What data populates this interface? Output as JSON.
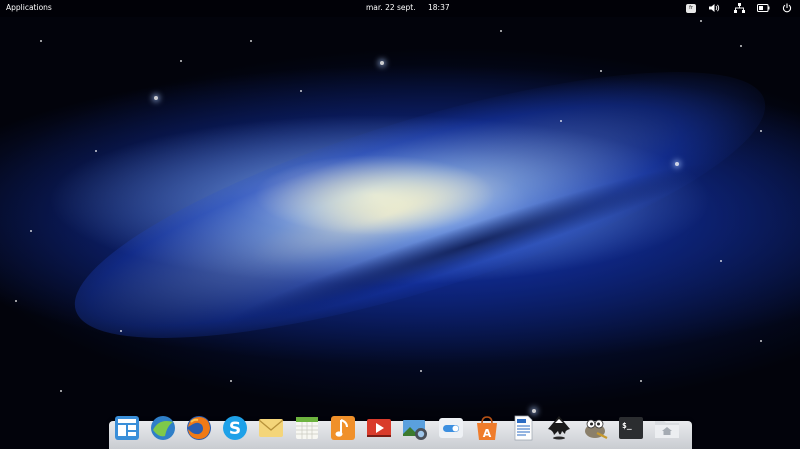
{
  "panel": {
    "applications_label": "Applications",
    "date": "mar. 22 sept.",
    "time": "18:37",
    "keyboard_layout": "fr"
  },
  "indicators": [
    {
      "name": "keyboard-layout",
      "icon": "keyboard-icon"
    },
    {
      "name": "sound",
      "icon": "volume-icon"
    },
    {
      "name": "network",
      "icon": "network-icon"
    },
    {
      "name": "battery",
      "icon": "battery-icon"
    },
    {
      "name": "session",
      "icon": "power-icon"
    }
  ],
  "dock": {
    "items": [
      {
        "name": "multitasking-view",
        "icon": "multitasking-icon"
      },
      {
        "name": "midori-browser",
        "icon": "midori-icon"
      },
      {
        "name": "firefox",
        "icon": "firefox-icon"
      },
      {
        "name": "skype",
        "icon": "skype-icon"
      },
      {
        "name": "mail",
        "icon": "mail-icon"
      },
      {
        "name": "calendar",
        "icon": "calendar-icon"
      },
      {
        "name": "music",
        "icon": "music-icon"
      },
      {
        "name": "videos",
        "icon": "videos-icon"
      },
      {
        "name": "photos",
        "icon": "photos-icon"
      },
      {
        "name": "system-settings",
        "icon": "settings-switch-icon"
      },
      {
        "name": "app-center",
        "icon": "app-center-icon"
      },
      {
        "name": "text-editor",
        "icon": "document-icon"
      },
      {
        "name": "inkscape",
        "icon": "inkscape-icon"
      },
      {
        "name": "gimp",
        "icon": "gimp-icon"
      },
      {
        "name": "terminal",
        "icon": "terminal-icon"
      },
      {
        "name": "files",
        "icon": "folder-icon"
      }
    ]
  },
  "colors": {
    "panel_text": "#ffffff",
    "dock_bg": "#dcdfe3",
    "space": "#02030b",
    "galaxy_blue": "#1f4fd6"
  }
}
